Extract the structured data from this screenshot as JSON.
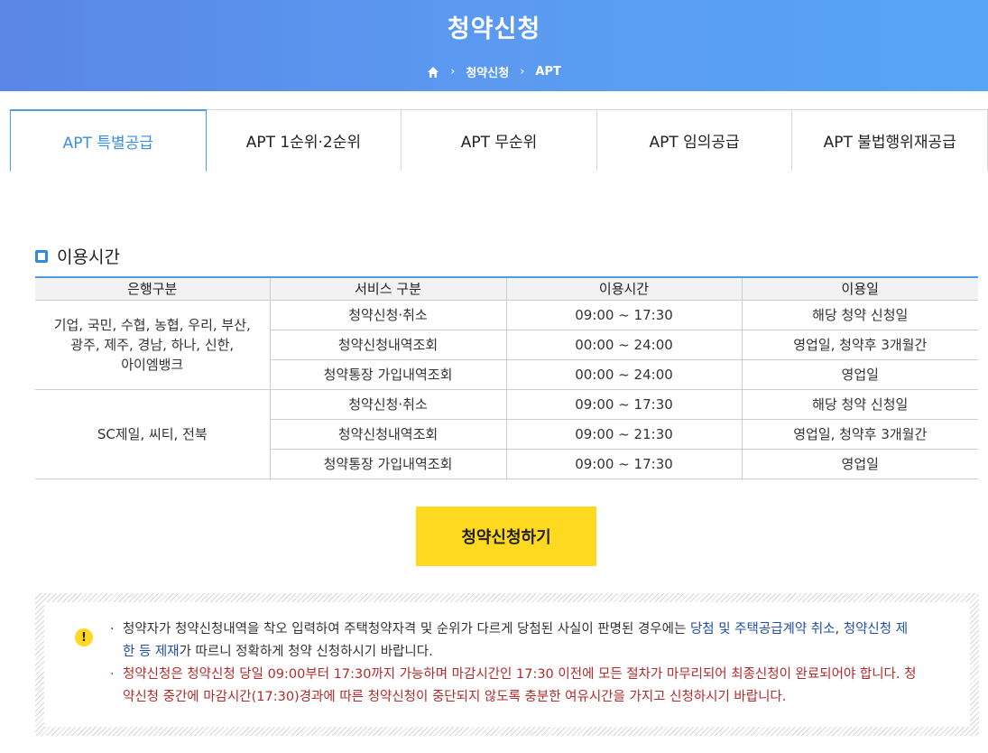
{
  "header": {
    "title": "청약신청",
    "breadcrumb": [
      "청약신청",
      "APT"
    ]
  },
  "tabs": [
    {
      "label": "APT 특별공급",
      "active": true
    },
    {
      "label": "APT 1순위·2순위",
      "active": false
    },
    {
      "label": "APT 무순위",
      "active": false
    },
    {
      "label": "APT 임의공급",
      "active": false
    },
    {
      "label": "APT 불법행위재공급",
      "active": false
    }
  ],
  "section": {
    "title": "이용시간"
  },
  "table": {
    "headers": [
      "은행구분",
      "서비스 구분",
      "이용시간",
      "이용일"
    ],
    "groups": [
      {
        "bank": "기업, 국민, 수협, 농협, 우리, 부산, 광주, 제주, 경남, 하나, 신한, 아이엠뱅크",
        "bank_lines": [
          "기업, 국민, 수협, 농협, 우리, 부산,",
          "광주, 제주, 경남, 하나, 신한,",
          "아이엠뱅크"
        ],
        "rows": [
          {
            "service": "청약신청·취소",
            "time": "09:00 ~ 17:30",
            "days": "해당 청약 신청일"
          },
          {
            "service": "청약신청내역조회",
            "time": "00:00 ~ 24:00",
            "days": "영업일, 청약후 3개월간"
          },
          {
            "service": "청약통장 가입내역조회",
            "time": "00:00 ~ 24:00",
            "days": "영업일"
          }
        ]
      },
      {
        "bank": "SC제일, 씨티, 전북",
        "bank_lines": [
          "SC제일, 씨티, 전북"
        ],
        "rows": [
          {
            "service": "청약신청·취소",
            "time": "09:00 ~ 17:30",
            "days": "해당 청약 신청일"
          },
          {
            "service": "청약신청내역조회",
            "time": "09:00 ~ 21:30",
            "days": "영업일, 청약후 3개월간"
          },
          {
            "service": "청약통장 가입내역조회",
            "time": "09:00 ~ 17:30",
            "days": "영업일"
          }
        ]
      }
    ]
  },
  "apply_button": {
    "label": "청약신청하기"
  },
  "notice": {
    "icon": "exclamation-icon",
    "note1": {
      "text_a": "청약자가 청약신청내역을 착오 입력하여 주택청약자격 및 순위가 다르게 당첨된 사실이 판명된 경우에는 ",
      "highlight_a": "당첨 및 주택공급계약 취소",
      "text_b": ", ",
      "highlight_b": "청약신청 제한 등 제재",
      "text_c": "가 따르니 정확하게 청약 신청하시기 바랍니다."
    },
    "note2": "청약신청은 청약신청 당일 09:00부터 17:30까지 가능하며 마감시간인 17:30 이전에 모든 절차가 마무리되어 최종신청이 완료되어야 합니다. 청약신청 중간에 마감시간(17:30)경과에 따른 청약신청이 중단되지 않도록 충분한 여유시간을 가지고 신청하시기 바랍니다."
  },
  "colors": {
    "header": "#5b9af0",
    "accent": "#4f9ce6",
    "button": "#ffd91f",
    "warning_text": "#b22a2a",
    "link": "#1f4fa8"
  }
}
